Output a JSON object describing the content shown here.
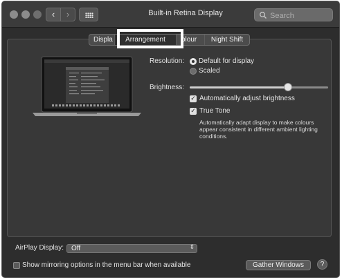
{
  "window": {
    "title": "Built-in Retina Display",
    "search_placeholder": "Search",
    "back_glyph": "‹",
    "forward_glyph": "›"
  },
  "tabs": [
    {
      "label": "Display",
      "selected": false
    },
    {
      "label": "Arrangement",
      "selected": true
    },
    {
      "label": "Colour",
      "selected": false
    },
    {
      "label": "Night Shift",
      "selected": false
    }
  ],
  "tab_visible": [
    "Displa",
    "Arrangement",
    "olour",
    "Night Shift"
  ],
  "resolution": {
    "label": "Resolution:",
    "options": [
      {
        "label": "Default for display",
        "selected": true
      },
      {
        "label": "Scaled",
        "selected": false
      }
    ]
  },
  "brightness": {
    "label": "Brightness:",
    "level": 0.71,
    "auto_adjust": {
      "label": "Automatically adjust brightness",
      "checked": true
    }
  },
  "true_tone": {
    "label": "True Tone",
    "checked": true,
    "description": "Automatically adapt display to make colours appear consistent in different ambient lighting conditions."
  },
  "airplay": {
    "label": "AirPlay Display:",
    "value": "Off"
  },
  "mirroring": {
    "label": "Show mirroring options in the menu bar when available",
    "checked": false
  },
  "buttons": {
    "gather": "Gather Windows",
    "help": "?"
  },
  "icons": [
    "close-dot",
    "minimize-dot",
    "zoom-dot",
    "chevron-left-icon",
    "chevron-right-icon",
    "grid-icon",
    "search-icon",
    "laptop-icon",
    "up-down-arrow-icon"
  ],
  "colors": {
    "window_bg": "#2d2d2d",
    "panel_bg": "#383838",
    "highlight_box": "#ffffff"
  }
}
